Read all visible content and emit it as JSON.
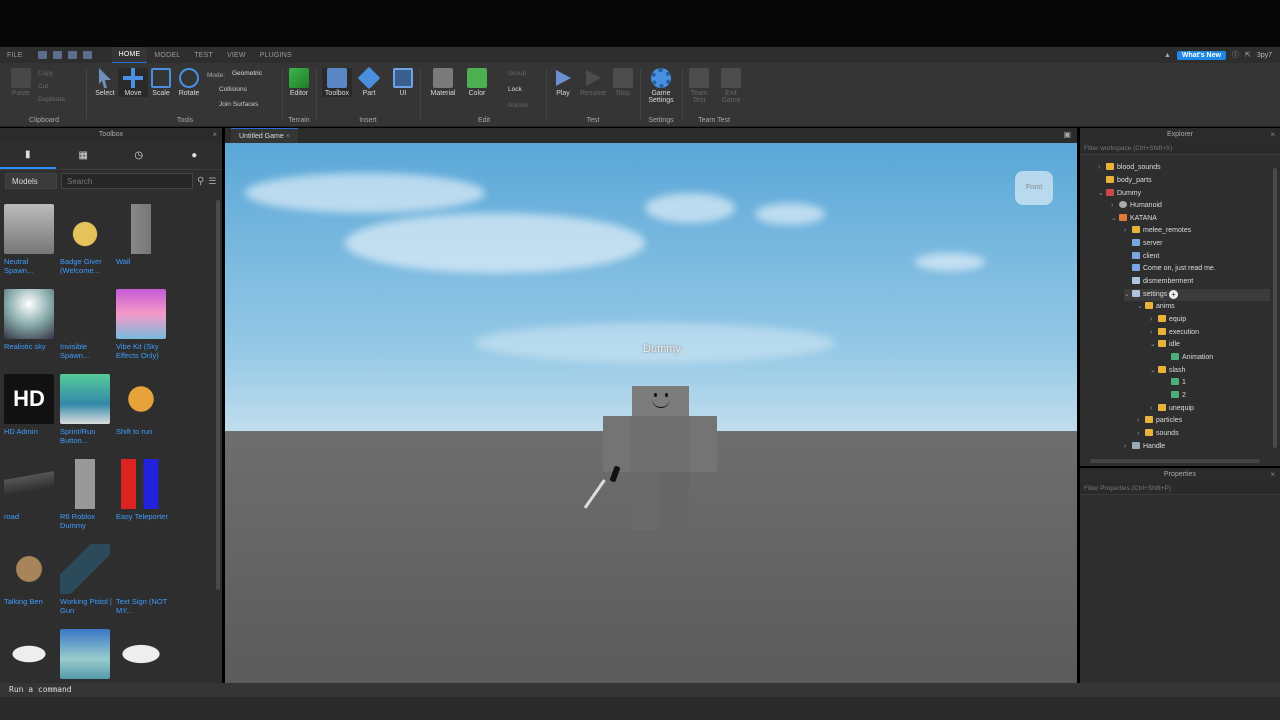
{
  "menu": {
    "file": "FILE",
    "tabs": [
      "HOME",
      "MODEL",
      "TEST",
      "VIEW",
      "PLUGINS"
    ],
    "active_tab": "HOME",
    "whats_new": "What's New",
    "user": "3py7"
  },
  "ribbon": {
    "clipboard": {
      "paste": "Paste",
      "copy": "Copy",
      "cut": "Cut",
      "duplicate": "Duplicate",
      "label": "Clipboard"
    },
    "tools": {
      "select": "Select",
      "move": "Move",
      "scale": "Scale",
      "rotate": "Rotate",
      "mode_label": "Mode:",
      "mode_value": "Geometric",
      "collisions": "Collisions",
      "join_surfaces": "Join Surfaces",
      "label": "Tools"
    },
    "terrain": {
      "editor": "Editor",
      "label": "Terrain"
    },
    "insert": {
      "toolbox": "Toolbox",
      "part": "Part",
      "ui": "UI",
      "label": "Insert"
    },
    "edit": {
      "material": "Material",
      "color": "Color",
      "group": "Group",
      "lock": "Lock",
      "anchor": "Anchor",
      "label": "Edit"
    },
    "test": {
      "play": "Play",
      "resume": "Resume",
      "stop": "Stop",
      "label": "Test"
    },
    "settings": {
      "game_settings": "Game Settings",
      "label": "Settings"
    },
    "team_test": {
      "team_test": "Team Test",
      "exit_game": "Exit Game",
      "label": "Team Test"
    }
  },
  "toolbox": {
    "title": "Toolbox",
    "category": "Models",
    "search_placeholder": "Search",
    "items": [
      "Neutral Spawn...",
      "Badge Giver (Welcome...",
      "Wall",
      "Realistic sky",
      "Invisible Spawn...",
      "Vibe Kit (Sky Effects Only)",
      "HD Admin",
      "Sprint/Run Button...",
      "Shift to run",
      "road",
      "R6 Roblox Dummy",
      "Easy Teleporter",
      "Talking Ben",
      "Working Pistol | Gun",
      "Text Sign (NOT MY..."
    ],
    "hd_label": "HD"
  },
  "document": {
    "tab": "Untitled Game",
    "character_name": "Dummy",
    "view_cube": "Front"
  },
  "explorer": {
    "title": "Explorer",
    "filter_placeholder": "Filter workspace (Ctrl+Shift+X)",
    "rows": [
      "blood_sounds",
      "body_parts",
      "Dummy",
      "Humanoid",
      "KATANA",
      "melee_remotes",
      "server",
      "client",
      "Come on, just read me.",
      "dismemberment",
      "settings",
      "anims",
      "equip",
      "execution",
      "idle",
      "Animation",
      "slash",
      "1",
      "2",
      "unequip",
      "particles",
      "sounds",
      "Handle"
    ]
  },
  "properties": {
    "title": "Properties",
    "filter_placeholder": "Filter Properties (Ctrl+Shift+P)"
  },
  "command": {
    "placeholder": "Run a command"
  },
  "colors": {
    "accent": "#2b8fff",
    "link": "#3f9dff",
    "whats_new": "#1e88e5"
  }
}
